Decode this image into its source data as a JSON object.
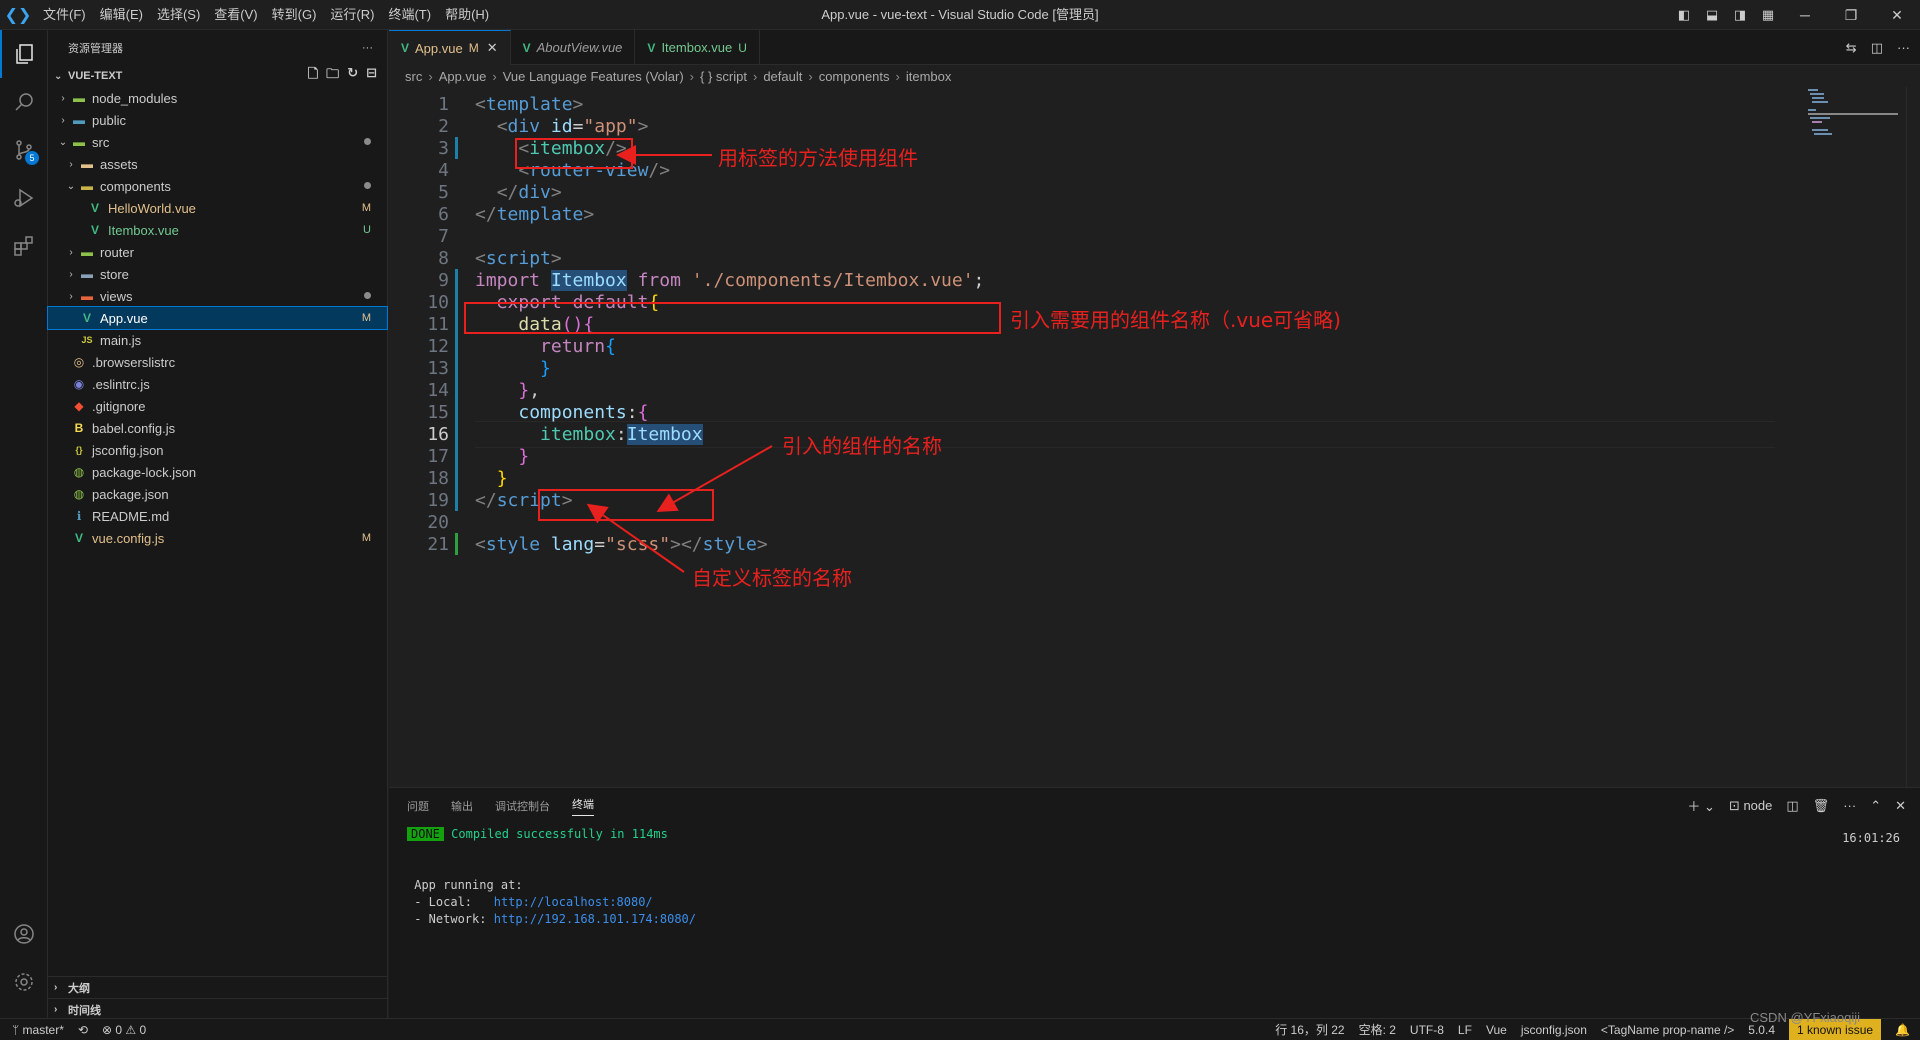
{
  "titlebar": {
    "menu": [
      "文件(F)",
      "编辑(E)",
      "选择(S)",
      "查看(V)",
      "转到(G)",
      "运行(R)",
      "终端(T)",
      "帮助(H)"
    ],
    "title": "App.vue - vue-text - Visual Studio Code [管理员]"
  },
  "activity": {
    "scm_badge": "5"
  },
  "sidebar": {
    "header": "资源管理器",
    "project": "VUE-TEXT",
    "tree": [
      {
        "label": "node_modules",
        "depth": 1,
        "kind": "folder",
        "chev": "›",
        "status": ""
      },
      {
        "label": "public",
        "depth": 1,
        "kind": "folder",
        "chev": "›",
        "status": ""
      },
      {
        "label": "src",
        "depth": 1,
        "kind": "folder-open",
        "chev": "⌄",
        "status": "dot"
      },
      {
        "label": "assets",
        "depth": 2,
        "kind": "folder",
        "chev": "›",
        "status": ""
      },
      {
        "label": "components",
        "depth": 2,
        "kind": "folder-open",
        "chev": "⌄",
        "status": "dot"
      },
      {
        "label": "HelloWorld.vue",
        "depth": 3,
        "kind": "vue",
        "chev": "",
        "status": "M"
      },
      {
        "label": "Itembox.vue",
        "depth": 3,
        "kind": "vue",
        "chev": "",
        "status": "U"
      },
      {
        "label": "router",
        "depth": 2,
        "kind": "folder",
        "chev": "›",
        "status": ""
      },
      {
        "label": "store",
        "depth": 2,
        "kind": "folder",
        "chev": "›",
        "status": ""
      },
      {
        "label": "views",
        "depth": 2,
        "kind": "folder",
        "chev": "›",
        "status": "dot"
      },
      {
        "label": "App.vue",
        "depth": 2,
        "kind": "vue",
        "chev": "",
        "status": "M",
        "selected": true
      },
      {
        "label": "main.js",
        "depth": 2,
        "kind": "js",
        "chev": "",
        "status": ""
      },
      {
        "label": ".browserslistrc",
        "depth": 1,
        "kind": "rc",
        "chev": "",
        "status": ""
      },
      {
        "label": ".eslintrc.js",
        "depth": 1,
        "kind": "eslint",
        "chev": "",
        "status": ""
      },
      {
        "label": ".gitignore",
        "depth": 1,
        "kind": "git",
        "chev": "",
        "status": ""
      },
      {
        "label": "babel.config.js",
        "depth": 1,
        "kind": "babel",
        "chev": "",
        "status": ""
      },
      {
        "label": "jsconfig.json",
        "depth": 1,
        "kind": "json",
        "chev": "",
        "status": ""
      },
      {
        "label": "package-lock.json",
        "depth": 1,
        "kind": "npm",
        "chev": "",
        "status": ""
      },
      {
        "label": "package.json",
        "depth": 1,
        "kind": "npm",
        "chev": "",
        "status": ""
      },
      {
        "label": "README.md",
        "depth": 1,
        "kind": "info",
        "chev": "",
        "status": ""
      },
      {
        "label": "vue.config.js",
        "depth": 1,
        "kind": "vue",
        "chev": "",
        "status": "M"
      }
    ],
    "outline": "大纲",
    "timeline": "时间线"
  },
  "tabs": [
    {
      "label": "App.vue",
      "status": "M",
      "active": true
    },
    {
      "label": "AboutView.vue",
      "status": "",
      "active": false
    },
    {
      "label": "Itembox.vue",
      "status": "U",
      "active": false
    }
  ],
  "breadcrumb": [
    "src",
    "App.vue",
    "Vue Language Features (Volar)",
    "{ } script",
    "default",
    "components",
    "itembox"
  ],
  "annotations": {
    "a1": "用标签的方法使用组件",
    "a2": "引入需要用的组件名称（.vue可省略)",
    "a3": "引入的组件的名称",
    "a4": "自定义标签的名称"
  },
  "panel": {
    "tabs": [
      "问题",
      "输出",
      "调试控制台",
      "终端"
    ],
    "shell": "node",
    "done": "DONE",
    "compiled": "Compiled successfully in 114ms",
    "time": "16:01:26",
    "app_running": "App running at:",
    "local_label": "- Local:   ",
    "local_url": "http://localhost:8080/",
    "network_label": "- Network: ",
    "network_url": "http://192.168.101.174:8080/"
  },
  "status": {
    "branch": "master*",
    "errors": "0",
    "warnings": "0",
    "position": "行 16，列 22",
    "spaces": "空格: 2",
    "encoding": "UTF-8",
    "eol": "LF",
    "lang": "Vue",
    "config": "jsconfig.json",
    "tag": "<TagName prop-name />",
    "version": "5.0.4",
    "issue": "1 known issue",
    "watermark": "CSDN @YFxiaoqiji"
  }
}
